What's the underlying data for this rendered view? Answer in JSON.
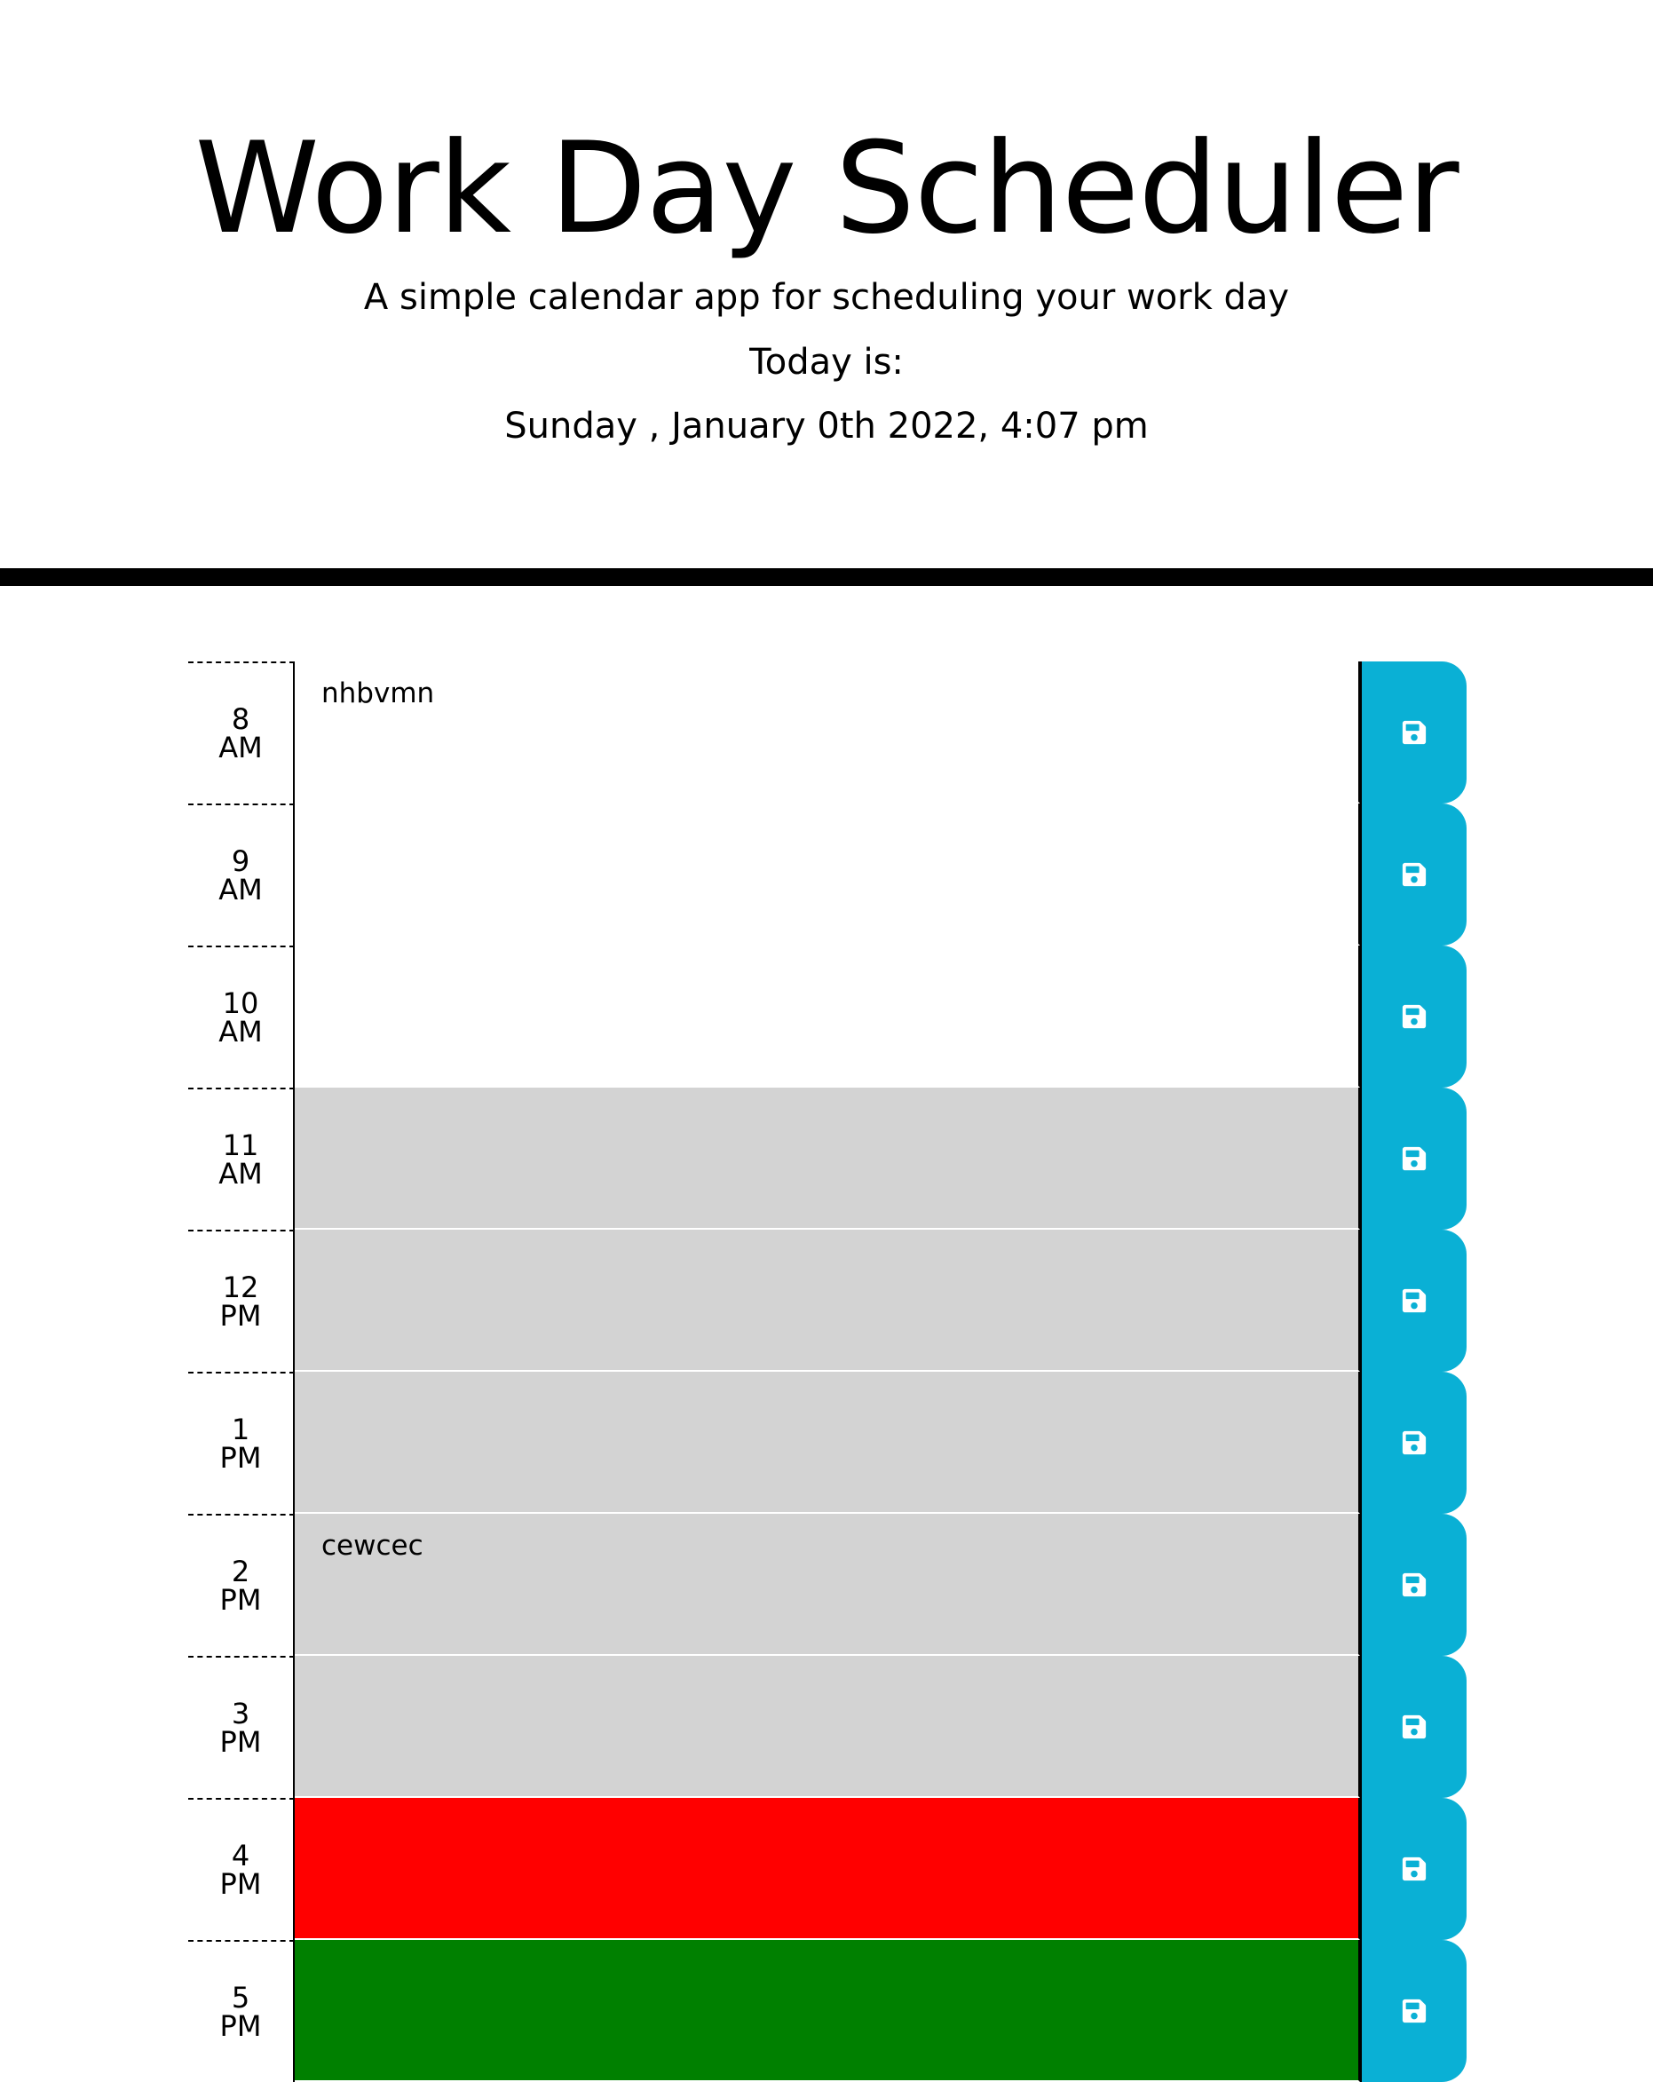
{
  "header": {
    "title": "Work Day Scheduler",
    "subtitle": "A simple calendar app for scheduling your work day",
    "today_label": "Today is:",
    "current_date": "Sunday , January 0th 2022, 4:07 pm"
  },
  "colors": {
    "past": "#d3d3d3",
    "present": "#ff0000",
    "future": "#008000",
    "save_button": "#0ab0d5"
  },
  "time_blocks": [
    {
      "hour_number": "8",
      "period": "AM",
      "text": "nhbvmn",
      "status": "future-white"
    },
    {
      "hour_number": "9",
      "period": "AM",
      "text": "",
      "status": "future-white"
    },
    {
      "hour_number": "10",
      "period": "AM",
      "text": "",
      "status": "future-white"
    },
    {
      "hour_number": "11",
      "period": "AM",
      "text": "",
      "status": "past"
    },
    {
      "hour_number": "12",
      "period": "PM",
      "text": "",
      "status": "past"
    },
    {
      "hour_number": "1",
      "period": "PM",
      "text": "",
      "status": "past"
    },
    {
      "hour_number": "2",
      "period": "PM",
      "text": "cewcec",
      "status": "past"
    },
    {
      "hour_number": "3",
      "period": "PM",
      "text": "",
      "status": "past"
    },
    {
      "hour_number": "4",
      "period": "PM",
      "text": "",
      "status": "present"
    },
    {
      "hour_number": "5",
      "period": "PM",
      "text": "",
      "status": "future"
    }
  ],
  "save_icon": "floppy-disk-icon"
}
